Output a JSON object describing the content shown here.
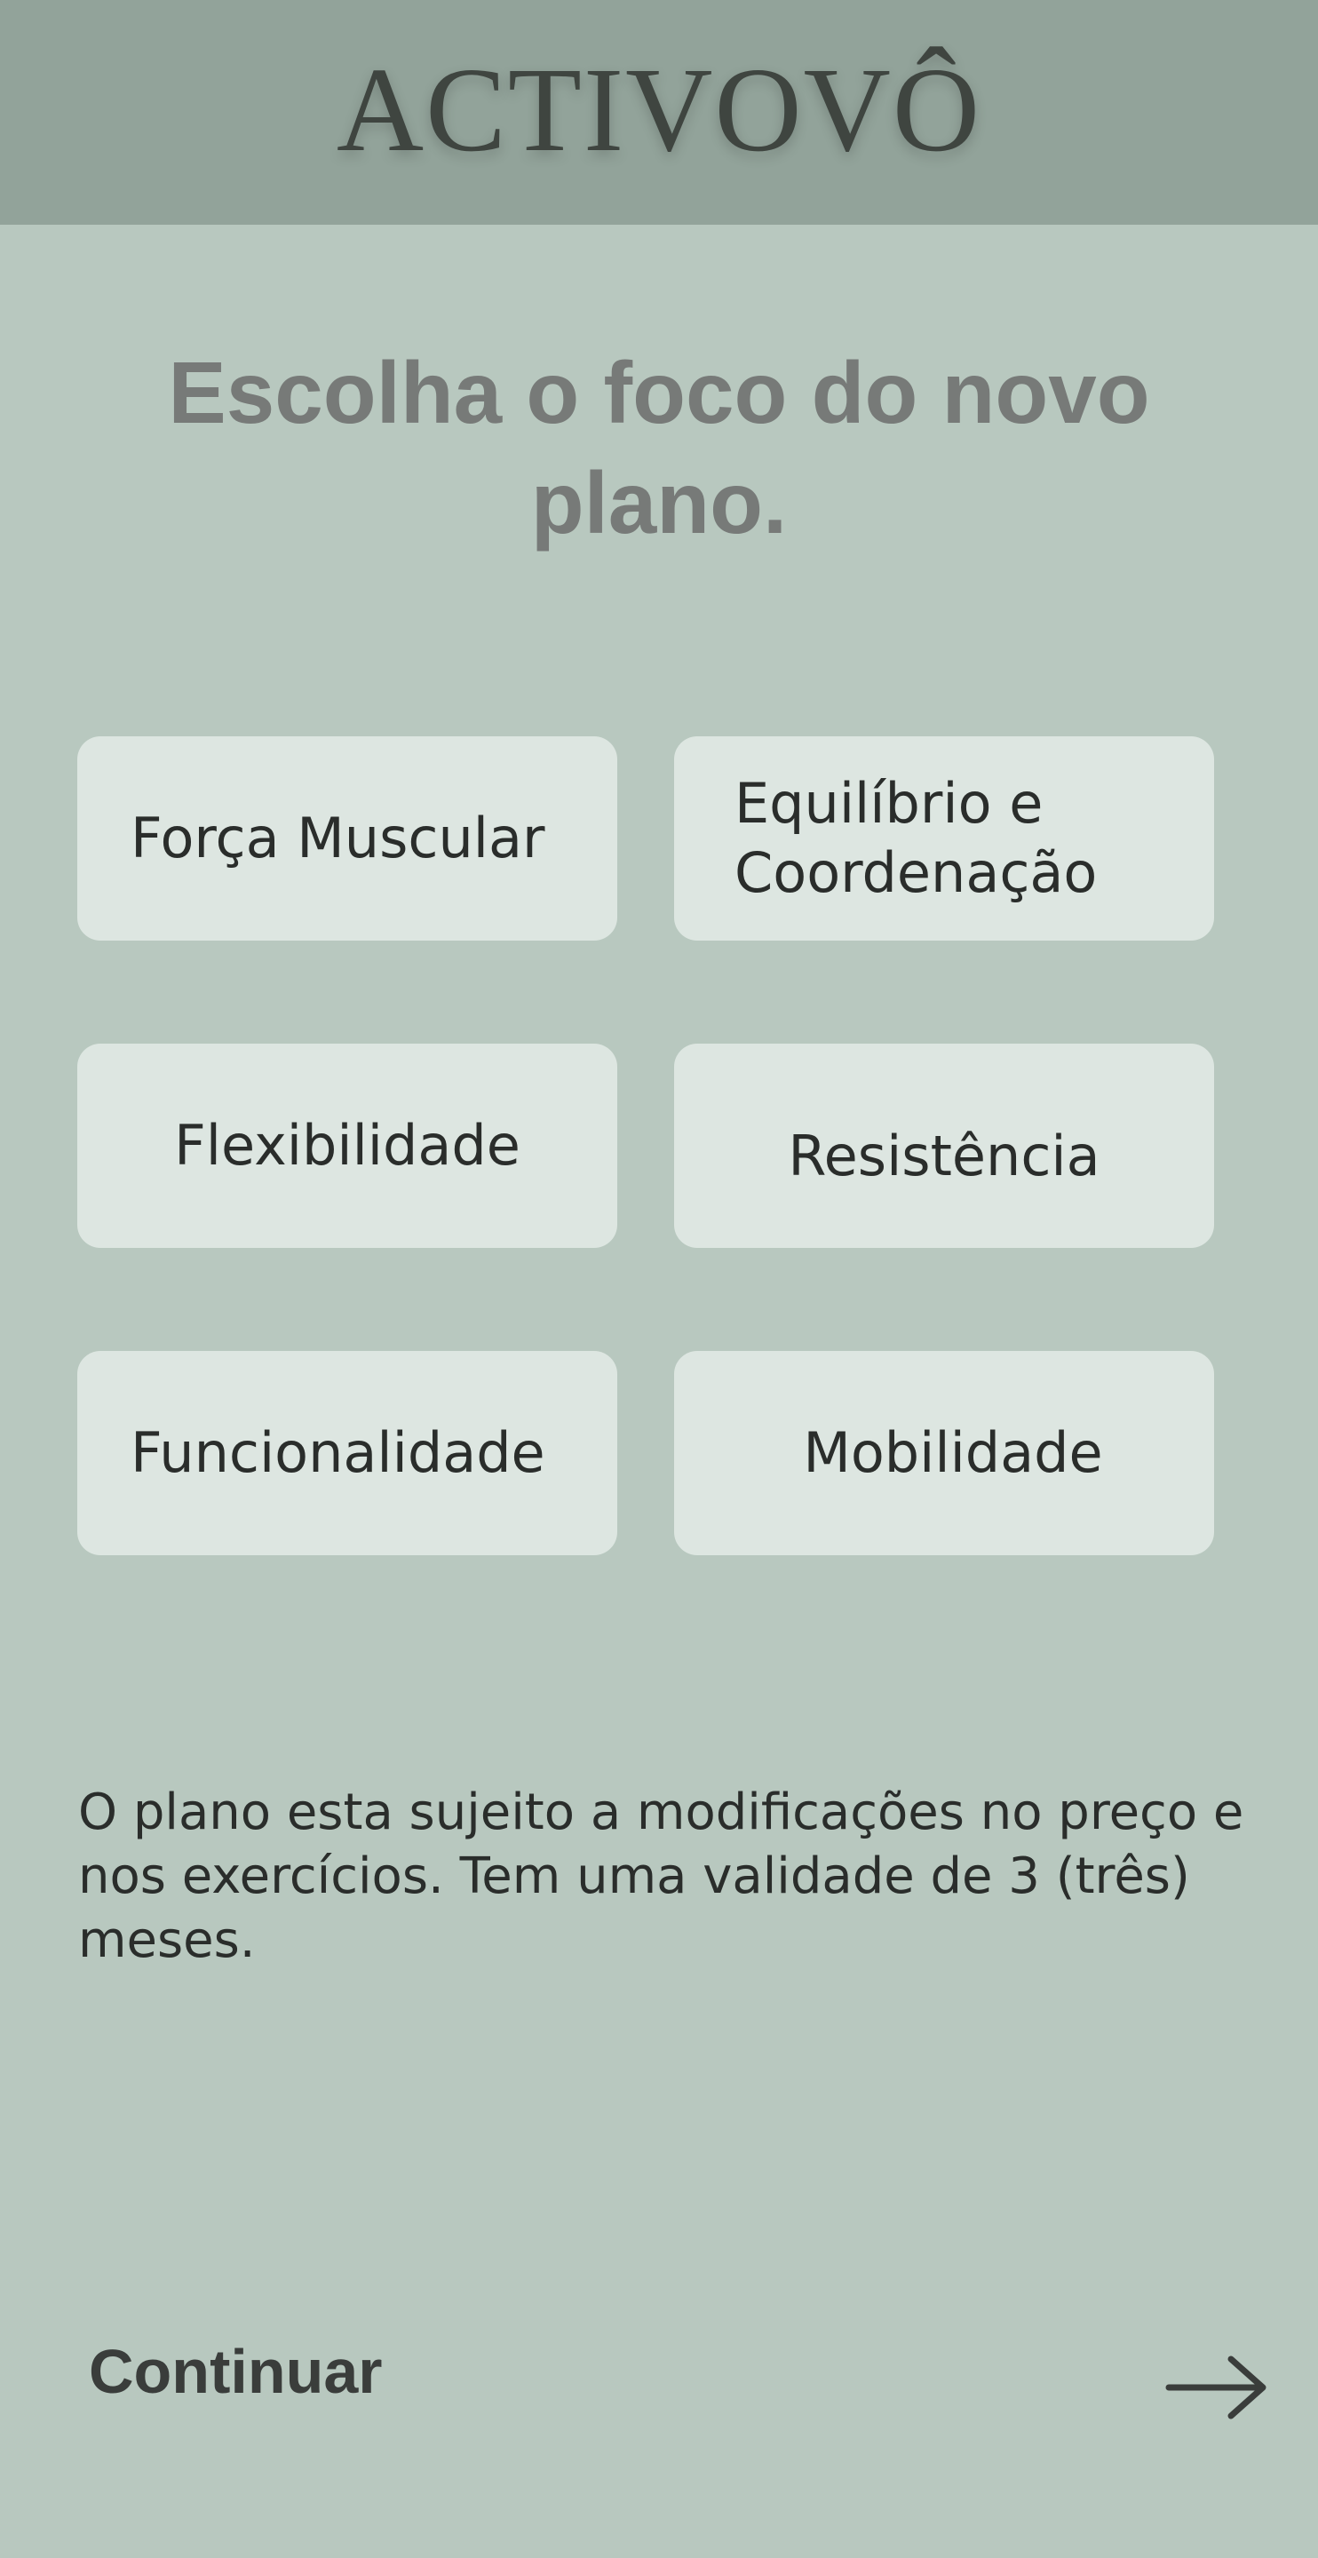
{
  "header": {
    "brand": "ACTIVOVÔ"
  },
  "main": {
    "title": "Escolha o foco do novo plano.",
    "options": [
      {
        "label": "Força Muscular"
      },
      {
        "label": "Equilíbrio e Coordenação"
      },
      {
        "label": "Flexibilidade"
      },
      {
        "label": "Resistência"
      },
      {
        "label": "Funcionalidade"
      },
      {
        "label": "Mobilidade"
      }
    ],
    "notice": "O plano esta sujeito a modificações no preço e nos exercícios. Tem uma validade de 3 (três) meses."
  },
  "footer": {
    "continue_label": "Continuar",
    "arrow_icon": "arrow-right-icon"
  },
  "colors": {
    "background": "#b8c8bf",
    "header": "#92a39a",
    "card": "#dde6e1",
    "title": "#777a78",
    "text": "#2a2d2b"
  }
}
